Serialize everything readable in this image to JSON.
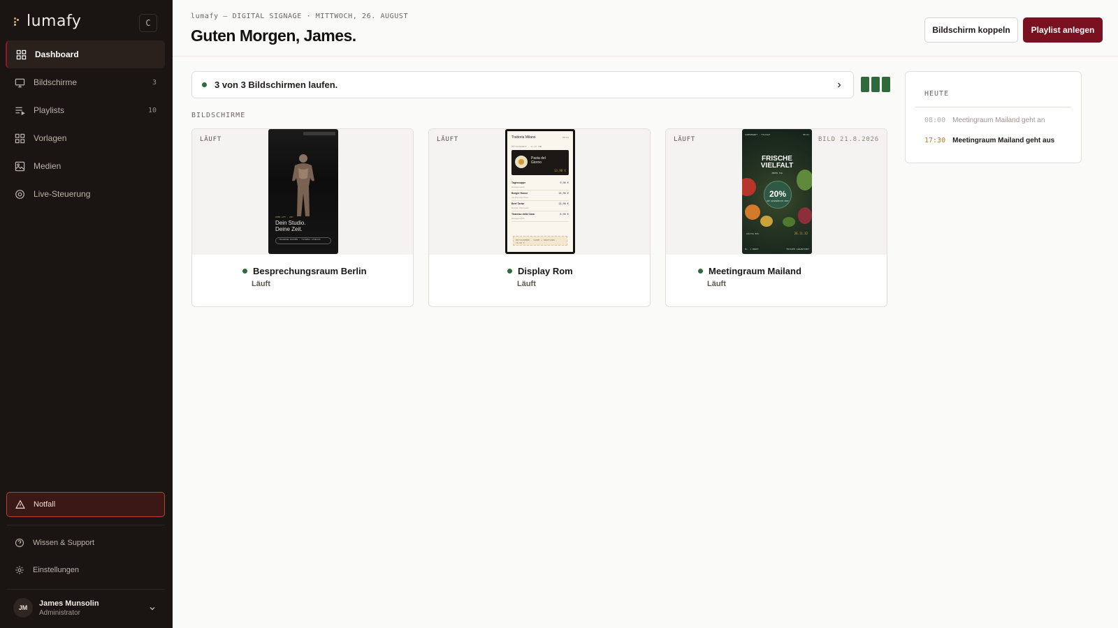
{
  "app": {
    "name": "lumafy",
    "collapse_glyph": "C"
  },
  "sidebar": {
    "items": [
      {
        "label": "Dashboard",
        "icon": "grid-icon",
        "active": true,
        "count": ""
      },
      {
        "label": "Bildschirme",
        "icon": "monitor-icon",
        "active": false,
        "count": "3"
      },
      {
        "label": "Playlists",
        "icon": "playlist-icon",
        "active": false,
        "count": "10"
      },
      {
        "label": "Vorlagen",
        "icon": "template-icon",
        "active": false,
        "count": ""
      },
      {
        "label": "Medien",
        "icon": "image-icon",
        "active": false,
        "count": ""
      },
      {
        "label": "Live-Steuerung",
        "icon": "live-control-icon",
        "active": false,
        "count": ""
      }
    ],
    "emergency_label": "Notfall",
    "support_label": "Wissen & Support",
    "settings_label": "Einstellungen",
    "user": {
      "initials": "JM",
      "name": "James Munsolin",
      "role": "Administrator"
    }
  },
  "header": {
    "eyebrow": "lumafy — DIGITAL SIGNAGE · MITTWOCH, 26. AUGUST",
    "title": "Guten Morgen, James.",
    "pair_button": "Bildschirm koppeln",
    "create_button": "Playlist anlegen"
  },
  "status": {
    "text": "3 von 3 Bildschirmen laufen.",
    "running": 3,
    "total": 3
  },
  "screens_section_label": "BILDSCHIRME",
  "screens": [
    {
      "status_tag": "LÄUFT",
      "right_tag": "",
      "name": "Besprechungsraum Berlin",
      "state": "Läuft",
      "preview": {
        "kicker": "OPEN GYM · 24H",
        "headline_1": "Dein Studio.",
        "headline_2": "Deine Zeit.",
        "cta": "TRAINING BUCHEN · FITNESS STUDIOS"
      }
    },
    {
      "status_tag": "LÄUFT",
      "right_tag": "",
      "name": "Display Rom",
      "state": "Läuft",
      "preview": {
        "title": "Trattoria Milano",
        "time": "08:01",
        "subheading": "MITTAGSKARTE · 11–15 UHR",
        "feature_title_1": "Pasta del",
        "feature_title_2": "Giorno",
        "feature_price": "13,90 €",
        "rows": [
          {
            "name": "Tagessuppe",
            "desc": "Hausgemacht",
            "price": "5,90 €"
          },
          {
            "name": "Burger House",
            "desc": "mit Pommes frites",
            "price": "15,90 €"
          },
          {
            "name": "Beef Tartar",
            "desc": "Rucola, Parmesan",
            "price": "13,90 €"
          },
          {
            "name": "Tiramisu della Casa",
            "desc": "Hausgemacht",
            "price": "6,90 €"
          }
        ],
        "note": "MITTAGSMENÜ · SUPPE + HAUPTGANG · 16,90 €"
      }
    },
    {
      "status_tag": "LÄUFT",
      "right_tag": "BILD 21.8.2026",
      "name": "Meetingraum Mailand",
      "state": "Läuft",
      "preview": {
        "top_left": "SUPERMARKT · FILIALE",
        "top_right": "08:01",
        "headline_1": "FRISCHE",
        "headline_2": "VIELFALT",
        "subline": "JEDEN TAG",
        "badge": "20%",
        "badge_sub": "AUF AUSGEWÄHLTES OBST",
        "price": "26.11.32",
        "label": "GÜLTIG BIS",
        "foot_left": "Nr. 1 MARKT",
        "foot_right": "FRISCHE GARANTIERT"
      }
    }
  ],
  "today": {
    "label": "HEUTE",
    "events": [
      {
        "time": "08:00",
        "text": "Meetingraum Mailand geht an",
        "past": true
      },
      {
        "time": "17:30",
        "text": "Meetingraum Mailand geht aus",
        "past": false
      }
    ]
  },
  "colors": {
    "accent": "#7a1120",
    "sidebar_bg": "#1a1412",
    "ok": "#2f6b3a",
    "time_highlight": "#b07d1f"
  }
}
